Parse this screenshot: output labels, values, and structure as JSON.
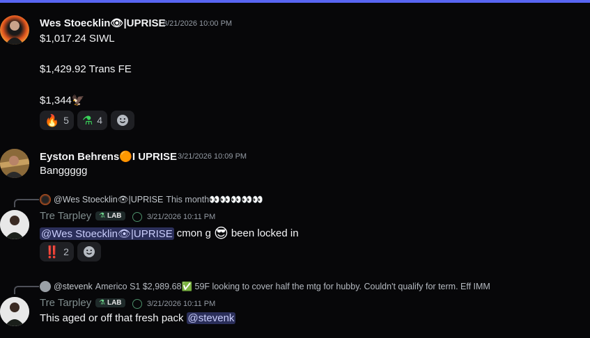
{
  "colors": {
    "accent": "#5865f2",
    "background": "#070709",
    "mention_bg": "#2b2f5a"
  },
  "messages": [
    {
      "author": "Wes Stoecklin👁|UPRISE",
      "timestamp": "3/21/2026 10:00 PM",
      "lines": [
        "$1,017.24 SIWL",
        "$1,429.92 Trans FE",
        "$1,344🦅"
      ],
      "reactions": [
        {
          "emoji": "🔥",
          "count": "5"
        },
        {
          "emoji": "⚗",
          "count": "4"
        }
      ]
    },
    {
      "author": "Eyston Behrens🟠I UPRISE",
      "timestamp": "3/21/2026 10:09 PM",
      "lines": [
        "Banggggg"
      ]
    },
    {
      "reply_to": {
        "author": "@Wes Stoecklin👁|UPRISE",
        "text": "This month👀👀👀👀👀"
      },
      "author": "Tre Tarpley",
      "tag": "LAB",
      "timestamp": "3/21/2026 10:11 PM",
      "mention": "@Wes Stoecklin👁|UPRISE",
      "text": "cmon g",
      "emoji": "😎",
      "text_after": "been locked in",
      "reactions": [
        {
          "emoji": "‼️",
          "count": "2"
        }
      ]
    },
    {
      "reply_to": {
        "author": "@stevenk",
        "text": "Americo S1 $2,989.68✅ 59F looking to cover half the mtg for hubby. Couldn't qualify for term.  Eff IMM"
      },
      "author": "Tre Tarpley",
      "tag": "LAB",
      "timestamp": "3/21/2026 10:11 PM",
      "text": "This aged or off that fresh pack",
      "mention": "@stevenk"
    }
  ]
}
